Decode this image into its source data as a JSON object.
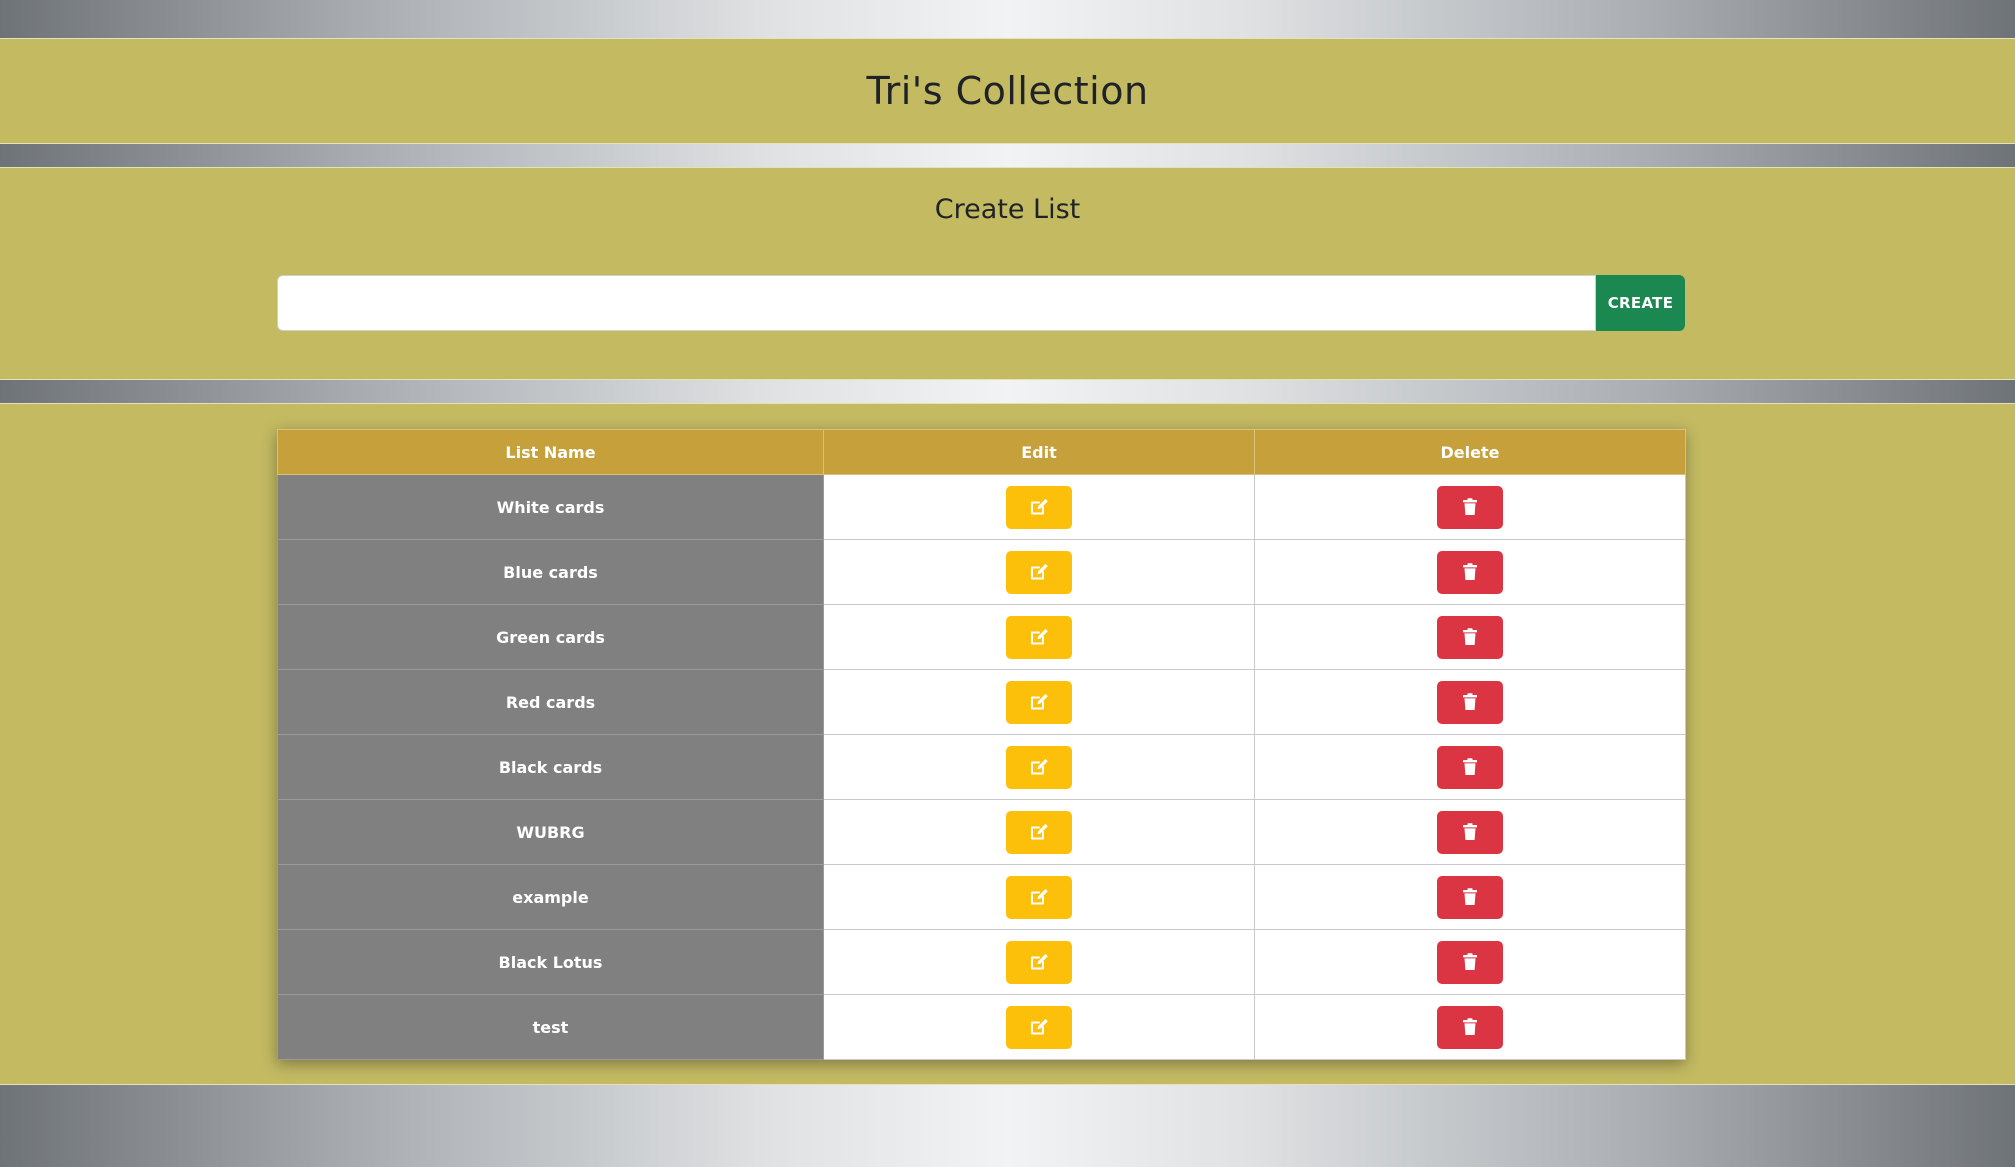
{
  "header": {
    "title": "Tri's Collection"
  },
  "create": {
    "title": "Create List",
    "input_value": "",
    "input_placeholder": "",
    "button_label": "CREATE"
  },
  "table": {
    "columns": [
      "List Name",
      "Edit",
      "Delete"
    ],
    "rows": [
      {
        "name": "White cards"
      },
      {
        "name": "Blue cards"
      },
      {
        "name": "Green cards"
      },
      {
        "name": "Red cards"
      },
      {
        "name": "Black cards"
      },
      {
        "name": "WUBRG"
      },
      {
        "name": "example"
      },
      {
        "name": "Black Lotus"
      },
      {
        "name": "test"
      }
    ],
    "edit_icon": "edit-icon",
    "delete_icon": "trash-icon"
  },
  "colors": {
    "band": "#c3ba62",
    "header_row": "#c5a03b",
    "name_cell": "#808080",
    "create_button": "#1b8751",
    "edit_button": "#fcbf0a",
    "delete_button": "#db3544"
  }
}
